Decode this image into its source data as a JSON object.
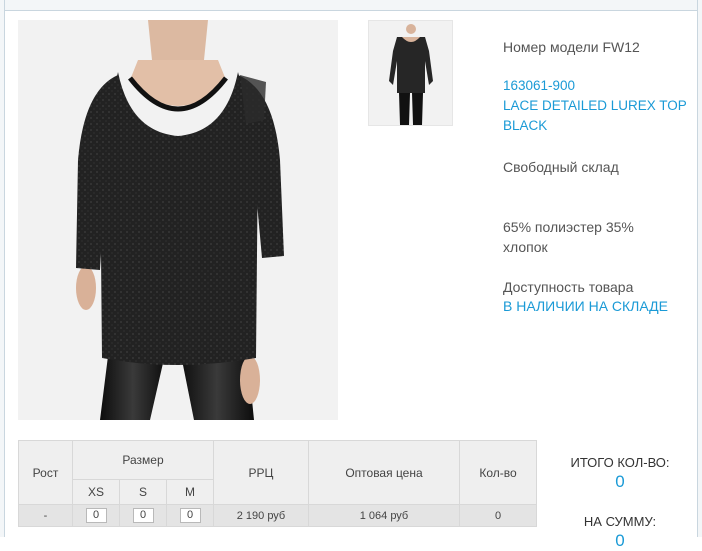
{
  "product": {
    "model_line": "Номер модели FW12",
    "article": "163061-900",
    "name_line1": "LACE DETAILED LUREX TOP",
    "name_line2": "BLACK",
    "warehouse": "Свободный склад",
    "composition_line1": "65% полиэстер 35%",
    "composition_line2": "хлопок",
    "availability_label": "Доступность товара",
    "availability_value": "В НАЛИЧИИ НА СКЛАДЕ"
  },
  "table": {
    "height_header": "Рост",
    "size_header": "Размер",
    "sizes": [
      "XS",
      "S",
      "M"
    ],
    "rrp_header": "РРЦ",
    "wholesale_header": "Оптовая цена",
    "qty_header": "Кол-во",
    "row": {
      "height": "-",
      "qty_inputs": [
        "0",
        "0",
        "0"
      ],
      "rrp": "2 190 руб",
      "wholesale": "1 064 руб",
      "qty": "0"
    }
  },
  "totals": {
    "total_qty_label": "ИТОГО КОЛ-ВО:",
    "total_qty_value": "0",
    "total_sum_label": "НА СУММУ:",
    "total_sum_value": "0"
  },
  "colors": {
    "accent": "#1a9ad6",
    "text": "#555555",
    "table_bg": "#efefef"
  }
}
